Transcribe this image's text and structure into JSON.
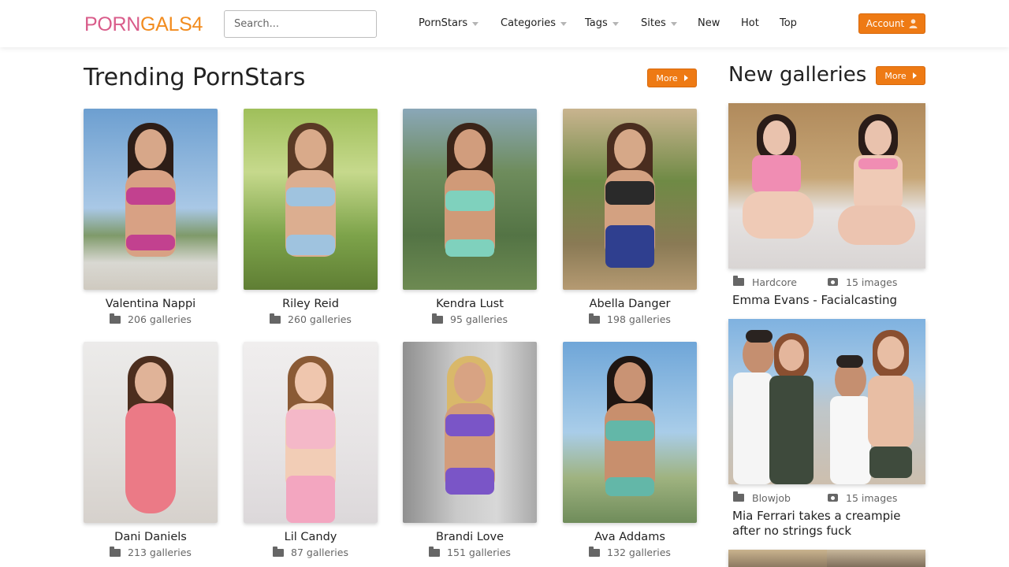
{
  "header": {
    "logo_part1": "PORN",
    "logo_part2": "GALS4",
    "search_placeholder": "Search...",
    "nav": [
      {
        "label": "PornStars",
        "dropdown": true
      },
      {
        "label": "Categories",
        "dropdown": true
      },
      {
        "label": "Tags",
        "dropdown": true
      },
      {
        "label": "Sites",
        "dropdown": true
      },
      {
        "label": "New",
        "dropdown": false
      },
      {
        "label": "Hot",
        "dropdown": false
      },
      {
        "label": "Top",
        "dropdown": false
      }
    ],
    "account_label": "Account",
    "account_icon": "user-icon"
  },
  "trending": {
    "title": "Trending PornStars",
    "more_label": "More",
    "stars": [
      {
        "name": "Valentina Nappi",
        "galleries": "206 galleries"
      },
      {
        "name": "Riley Reid",
        "galleries": "260 galleries"
      },
      {
        "name": "Kendra Lust",
        "galleries": "95 galleries"
      },
      {
        "name": "Abella Danger",
        "galleries": "198 galleries"
      },
      {
        "name": "Dani Daniels",
        "galleries": "213 galleries"
      },
      {
        "name": "Lil Candy",
        "galleries": "87 galleries"
      },
      {
        "name": "Brandi Love",
        "galleries": "151 galleries"
      },
      {
        "name": "Ava Addams",
        "galleries": "132 galleries"
      }
    ]
  },
  "new_galleries": {
    "title": "New galleries",
    "more_label": "More",
    "items": [
      {
        "category": "Hardcore",
        "images": "15 images",
        "title": "Emma Evans - Facialcasting"
      },
      {
        "category": "Blowjob",
        "images": "15 images",
        "title": "Mia Ferrari takes a creampie after no strings fuck"
      }
    ]
  },
  "colors": {
    "accent": "#ee7a14",
    "logo_pink": "#d95c8a",
    "logo_orange": "#f28c1f"
  }
}
